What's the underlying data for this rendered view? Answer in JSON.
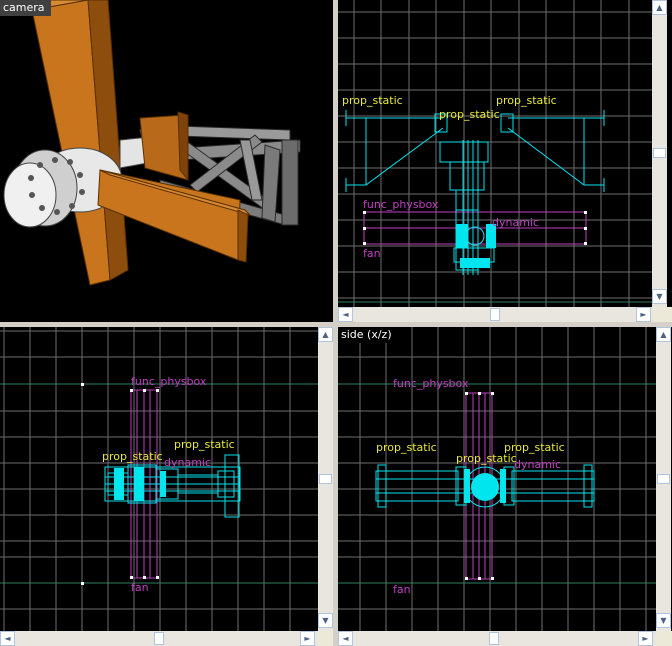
{
  "viewports": {
    "camera": {
      "title": "camera"
    },
    "top": {
      "title": ""
    },
    "front": {
      "title": ""
    },
    "side": {
      "title": "side (x/z)"
    }
  },
  "entity_labels": {
    "top": {
      "prop_static_left": "prop_static",
      "prop_static_center": "prop_static",
      "prop_static_right": "prop_static",
      "func_physbox": "func_physbox",
      "dynamic": "dynamic",
      "fan": "fan"
    },
    "front": {
      "func_physbox": "func_physbox",
      "prop_static_upper": "prop_static",
      "prop_static_lower": "prop_static",
      "dynamic": "dynamic",
      "fan": "fan"
    },
    "side": {
      "func_physbox": "func_physbox",
      "prop_static_left": "prop_static",
      "prop_static_center": "prop_static",
      "prop_static_right": "prop_static",
      "dynamic": "dynamic",
      "fan": "fan"
    }
  },
  "scrollbar_glyphs": {
    "up": "▲",
    "down": "▼",
    "left": "◄",
    "right": "►"
  },
  "colors": {
    "grid": "#6e6e6e",
    "axis": "#2f7f5f",
    "wireframe": "#00e5ee",
    "selection": "#c040c0",
    "label": "#e8e83a",
    "wood": "#c8751e",
    "metal": "#8c8c8c"
  }
}
